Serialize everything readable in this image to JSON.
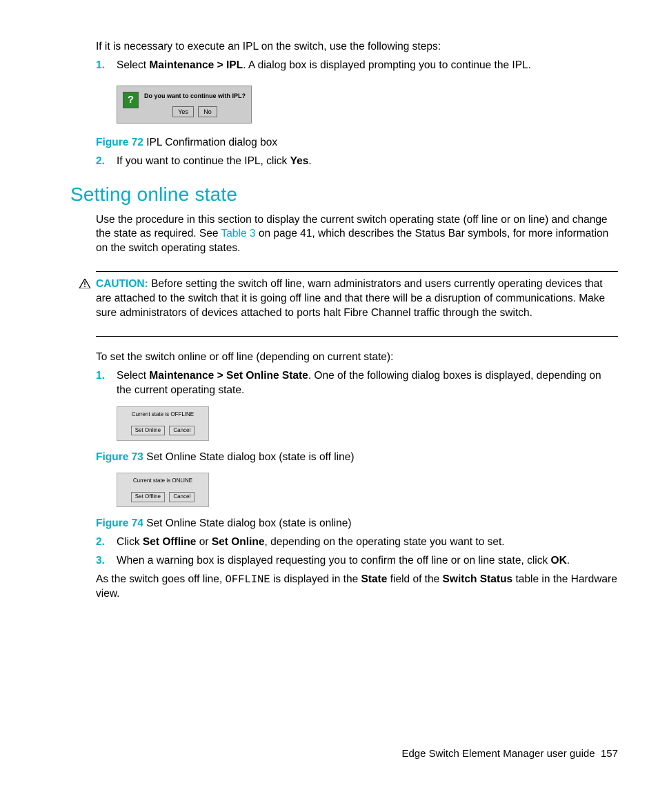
{
  "intro": "If it is necessary to execute an IPL on the switch, use the following steps:",
  "list1": {
    "n1": "1.",
    "i1a": "Select ",
    "i1b": "Maintenance > IPL",
    "i1c": ". A dialog box is displayed prompting you to continue the IPL."
  },
  "dlg1": {
    "text": "Do you want to continue with IPL?",
    "yes": "Yes",
    "no": "No"
  },
  "fig72": {
    "label": "Figure 72",
    "text": " IPL Confirmation dialog box"
  },
  "list1b": {
    "n2": "2.",
    "i2a": "If you want to continue the IPL, click ",
    "i2b": "Yes",
    "i2c": "."
  },
  "heading": "Setting online state",
  "para1a": "Use the procedure in this section to display the current switch operating state (off line or on line) and change the state as required. See ",
  "para1link": "Table 3",
  "para1b": " on page 41, which describes the Status Bar symbols, for more information on the switch operating states.",
  "caution": {
    "label": "CAUTION:",
    "text": "   Before setting the switch off line, warn administrators and users currently operating devices that are attached to the switch that it is going off line and that there will be a disruption of communications. Make sure administrators of devices attached to ports halt Fibre Channel traffic through the switch."
  },
  "para2": "To set the switch online or off line (depending on current state):",
  "list2": {
    "n1": "1.",
    "i1a": "Select ",
    "i1b": "Maintenance > Set Online State",
    "i1c": ". One of the following dialog boxes is displayed, depending on the current operating state."
  },
  "dlg2": {
    "text": "Current state is  OFFLINE",
    "b1": "Set Online",
    "b2": "Cancel"
  },
  "fig73": {
    "label": "Figure 73",
    "text": " Set Online State dialog box (state is off line)"
  },
  "dlg3": {
    "text": "Current state is  ONLINE",
    "b1": "Set Offline",
    "b2": "Cancel"
  },
  "fig74": {
    "label": "Figure 74",
    "text": " Set Online State dialog box (state is online)"
  },
  "list2b": {
    "n2": "2.",
    "i2a": "Click ",
    "i2b": "Set Offline",
    "i2c": " or ",
    "i2d": "Set Online",
    "i2e": ", depending on the operating state you want to set.",
    "n3": "3.",
    "i3a": "When a warning box is displayed requesting you to confirm the off line or on line state, click ",
    "i3b": "OK",
    "i3c": "."
  },
  "para3a": "As the switch goes off line, ",
  "para3code": "OFFLINE",
  "para3b": " is displayed in the ",
  "para3c": "State",
  "para3d": " field of the ",
  "para3e": "Switch Status",
  "para3f": " table in the Hardware view.",
  "footer": {
    "text": "Edge Switch Element Manager user guide",
    "page": "157"
  }
}
